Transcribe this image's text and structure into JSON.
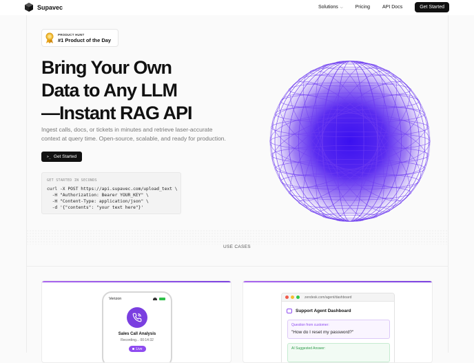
{
  "nav": {
    "brand": "Supavec",
    "links": [
      "Solutions",
      "Pricing",
      "API Docs"
    ],
    "cta": "Get Started"
  },
  "badge": {
    "small": "PRODUCT HUNT",
    "big": "#1 Product of the Day"
  },
  "hero": {
    "headline": [
      "Bring Your Own",
      "Data to Any LLM",
      "—Instant RAG API"
    ],
    "subtext": [
      "Ingest calls, docs, or tickets in minutes and retrieve laser-accurate",
      "context at query time. Open-source, scalable, and ready for production."
    ],
    "cta": "Get Started",
    "cta_glyph": ">_"
  },
  "code": {
    "title": "GET STARTED IN SECONDS",
    "lines": [
      "curl -X POST https://api.supavec.com/upload_text \\",
      "  -H \"Authorization: Bearer YOUR_KEY\" \\",
      "  -H \"Content-Type: application/json\" \\",
      "  -d '{\"contents\": \"your text here\"}'"
    ]
  },
  "section": {
    "use_cases": "USE CASES"
  },
  "card_phone": {
    "carrier": "Verizon",
    "title": "Sales Call Analysis",
    "subtitle": "Recording... 00:14:32",
    "live": "Live"
  },
  "card_support": {
    "url": "zendesk.com/agent/dashboard",
    "title": "Support Agent Dashboard",
    "question_label": "Question from customer:",
    "question": "\"How do I reset my password?\"",
    "answer_label": "AI Suggested Answer:"
  },
  "colors": {
    "accent": "#7a3fe0",
    "dark": "#111111",
    "globe_core": "#4b1fe6"
  },
  "icons": {
    "logo": "cube-icon",
    "badge": "medal-icon",
    "call": "phone-icon",
    "chat": "chat-icon",
    "dropdown": "chevron-down-icon",
    "terminal": "terminal-icon"
  }
}
